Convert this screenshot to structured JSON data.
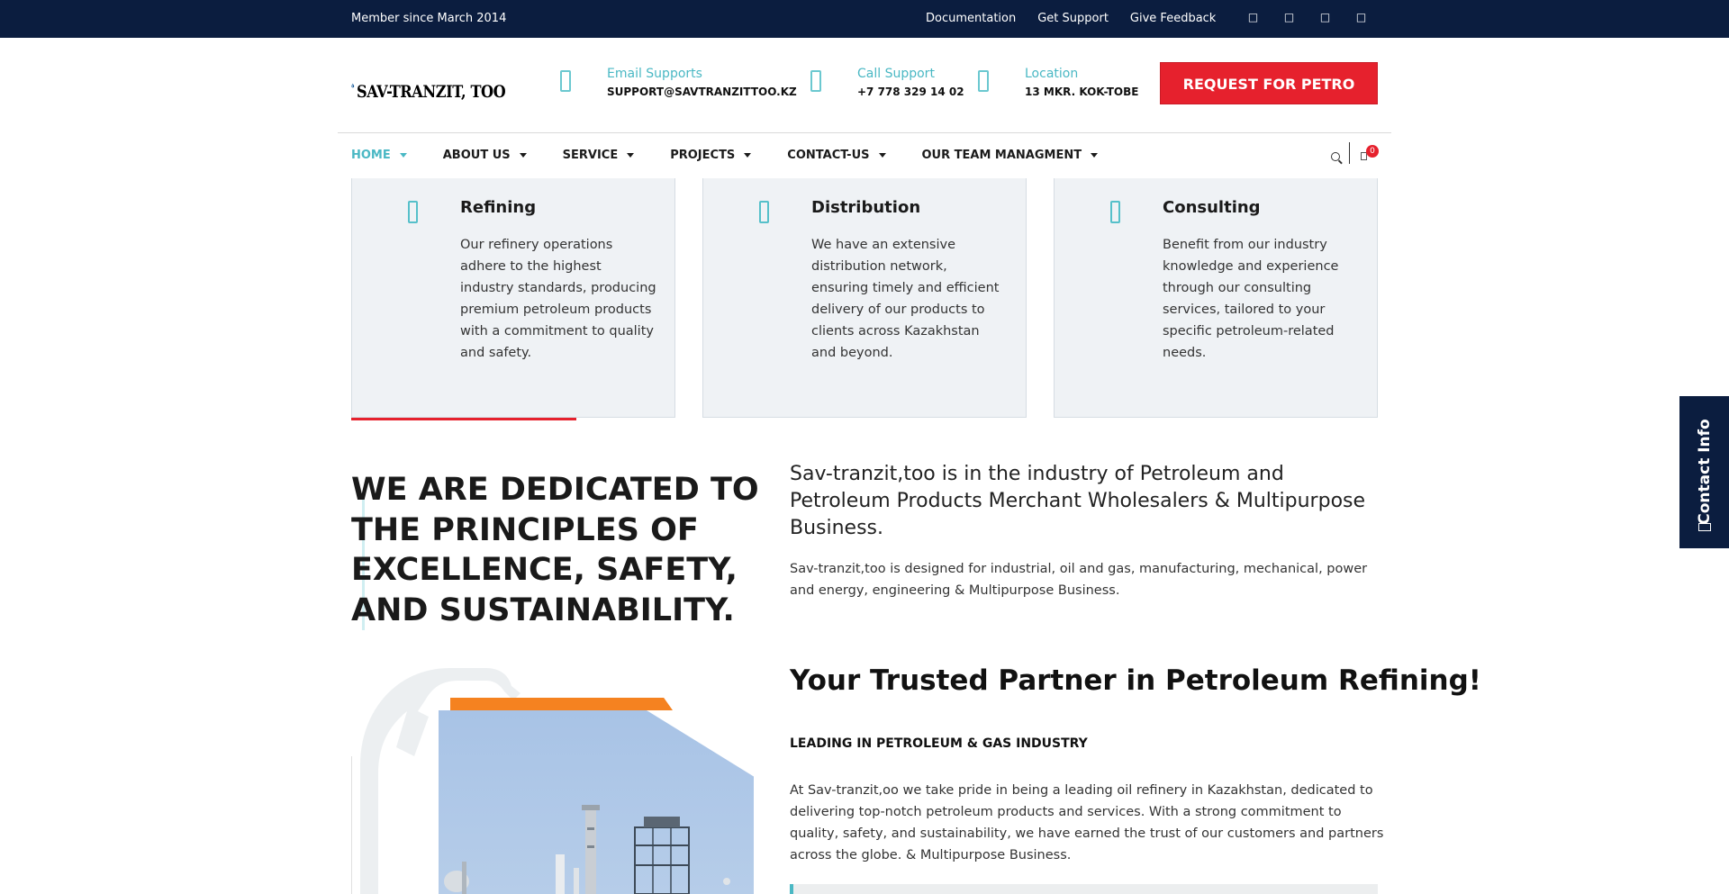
{
  "topbar": {
    "member_text": "Member since March 2014",
    "links": [
      "Documentation",
      "Get Support",
      "Give Feedback"
    ],
    "social_icons": [
      "facebook-icon",
      "twitter-icon",
      "linkedin-icon",
      "instagram-icon"
    ]
  },
  "header": {
    "logo_text": "SAV-TRANZIT, TOO",
    "email": {
      "label": "Email Supports",
      "value": "SUPPORT@SAVTRANZITTOO.KZ"
    },
    "phone": {
      "label": "Call Support",
      "value": "+7 778 329 14 02"
    },
    "location": {
      "label": "Location",
      "value": "13 MKR. KOK-TOBE"
    },
    "request_button": "REQUEST FOR PETRO"
  },
  "nav": {
    "items": [
      "HOME",
      "ABOUT US",
      "SERVICE",
      "PROJECTS",
      "CONTACT-US",
      "OUR TEAM MANAGMENT"
    ],
    "active_index": 0,
    "cart_count": "0"
  },
  "services": [
    {
      "title": "Refining",
      "text": "Our refinery operations adhere to the highest industry standards, producing premium petroleum products with a commitment to quality and safety."
    },
    {
      "title": "Distribution",
      "text": "We have an extensive distribution network, ensuring timely and efficient delivery of our products to clients across Kazakhstan and beyond."
    },
    {
      "title": "Consulting",
      "text": "Benefit from our industry knowledge and experience through our consulting services, tailored to your specific petroleum-related needs."
    }
  ],
  "about": {
    "headline": "WE ARE DEDICATED TO THE PRINCIPLES OF EXCELLENCE, SAFETY, AND SUSTAINABILITY.",
    "lead": "Sav-tranzit,too is in the industry of Petroleum and Petroleum Products Merchant Wholesalers & Multipurpose Business.",
    "paragraph": "Sav-tranzit,too is designed for industrial, oil and gas, manufacturing, mechanical, power and energy, engineering & Multipurpose Business.",
    "heading2": "Your Trusted Partner in Petroleum Refining!",
    "subheading": "LEADING IN PETROLEUM & GAS INDUSTRY",
    "paragraph2": "At Sav-tranzit,oo we take pride in being a leading oil refinery in Kazakhstan, dedicated to delivering top-notch petroleum products and services. With a strong commitment to quality, safety, and sustainability, we have earned the trust of our customers and partners across the globe. & Multipurpose Business."
  },
  "side_tab": {
    "label": "Contact Info"
  },
  "colors": {
    "navy": "#0b1d3f",
    "teal": "#4ab8c4",
    "red": "#e6212d",
    "orange": "#f58220",
    "card_bg": "#eff2f5"
  }
}
